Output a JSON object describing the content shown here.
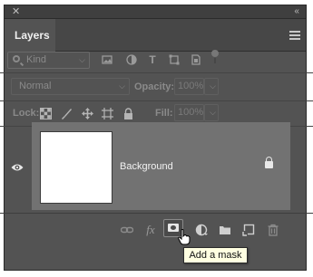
{
  "window": {
    "close_glyph": "✕",
    "collapse_glyph": "‹‹"
  },
  "panel": {
    "tab_label": "Layers"
  },
  "filter": {
    "kind_label": "Kind"
  },
  "blend": {
    "mode": "Normal",
    "opacity_label": "Opacity:",
    "opacity_value": "100%"
  },
  "lock": {
    "label": "Lock:",
    "fill_label": "Fill:",
    "fill_value": "100%"
  },
  "layers": [
    {
      "name": "Background",
      "locked": true,
      "visible": true
    }
  ],
  "bottom_bar": {
    "buttons": [
      "link-layers",
      "fx",
      "add-mask",
      "adjustment",
      "group",
      "new-layer",
      "delete"
    ],
    "fx_label": "fx"
  },
  "tooltip": {
    "text": "Add a mask"
  },
  "colors": {
    "panel": "#535353",
    "layer_selected": "#727272",
    "tooltip_bg": "#ffffe1"
  }
}
